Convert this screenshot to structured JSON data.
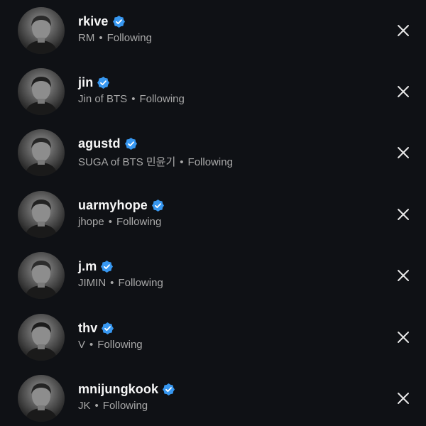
{
  "accounts": [
    {
      "username": "rkive",
      "subtitle": "RM",
      "status": "Following",
      "verified": true
    },
    {
      "username": "jin",
      "subtitle": "Jin of BTS",
      "status": "Following",
      "verified": true
    },
    {
      "username": "agustd",
      "subtitle": "SUGA of BTS 민윤기",
      "status": "Following",
      "verified": true
    },
    {
      "username": "uarmyhope",
      "subtitle": "jhope",
      "status": "Following",
      "verified": true
    },
    {
      "username": "j.m",
      "subtitle": "JIMIN",
      "status": "Following",
      "verified": true
    },
    {
      "username": "thv",
      "subtitle": "V",
      "status": "Following",
      "verified": true
    },
    {
      "username": "mnijungkook",
      "subtitle": "JK",
      "status": "Following",
      "verified": true
    }
  ],
  "separator": "•",
  "icons": {
    "verified": "verified-badge-icon",
    "remove": "close-icon",
    "avatar": "profile-photo"
  },
  "colors": {
    "background": "#0f1115",
    "verified_badge": "#3797f0",
    "secondary_text": "#a8a8a8"
  }
}
